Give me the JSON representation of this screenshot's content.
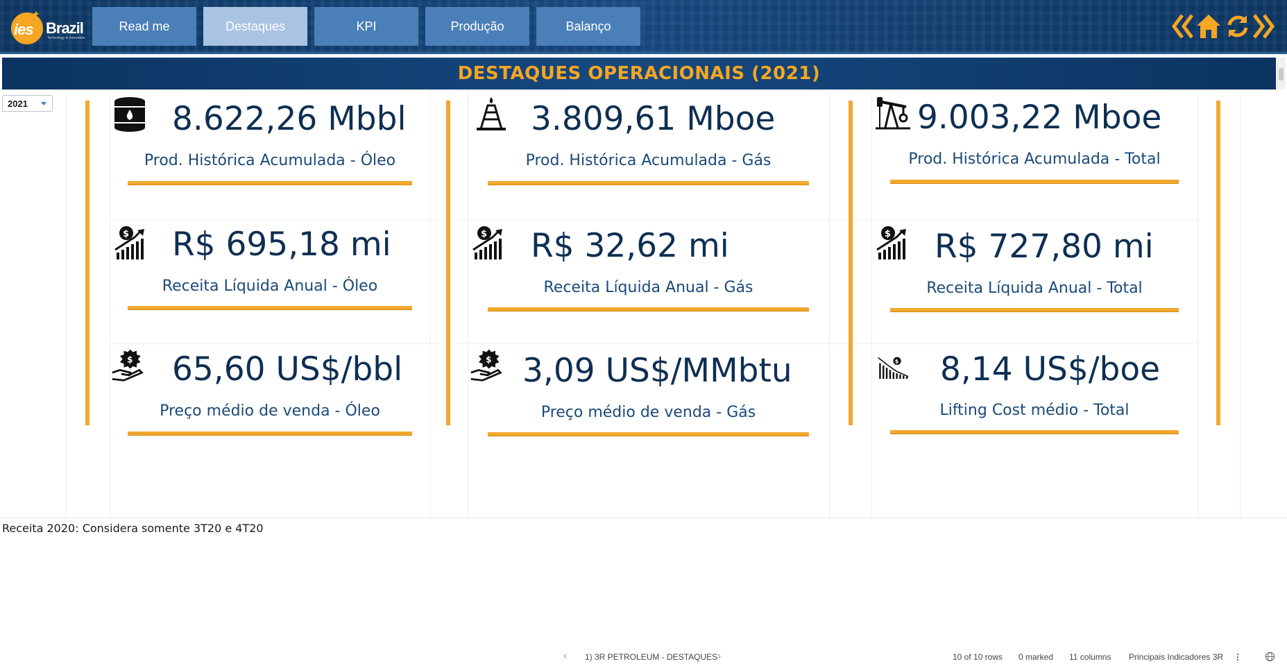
{
  "header": {
    "logo_primary": "ies",
    "logo_secondary": "Brazil",
    "logo_tagline": "Technology & Innovation",
    "nav": [
      {
        "label": "Read me",
        "active": false
      },
      {
        "label": "Destaques",
        "active": true
      },
      {
        "label": "KPI",
        "active": false
      },
      {
        "label": "Produção",
        "active": false
      },
      {
        "label": "Balanço",
        "active": false
      }
    ],
    "icons": [
      "back-icon",
      "home-icon",
      "refresh-icon",
      "forward-icon"
    ]
  },
  "banner": {
    "title": "DESTAQUES OPERACIONAIS (2021)"
  },
  "filter": {
    "year": "2021"
  },
  "kpis": {
    "oil_prod": {
      "value": "8.622,26 Mbbl",
      "label": "Prod. Histórica Acumulada - Óleo",
      "icon": "oil-barrel-icon"
    },
    "gas_prod": {
      "value": "3.809,61 Mboe",
      "label": "Prod. Histórica Acumulada - Gás",
      "icon": "gas-rig-icon"
    },
    "total_prod": {
      "value": "9.003,22 Mboe",
      "label": "Prod. Histórica Acumulada - Total",
      "icon": "pumpjack-icon"
    },
    "oil_rev": {
      "value": "R$ 695,18 mi",
      "label": "Receita Líquida Anual - Óleo",
      "icon": "revenue-growth-icon"
    },
    "gas_rev": {
      "value": "R$ 32,62 mi",
      "label": "Receita Líquida Anual - Gás",
      "icon": "revenue-growth-icon"
    },
    "total_rev": {
      "value": "R$ 727,80 mi",
      "label": "Receita Líquida Anual - Total",
      "icon": "revenue-growth-icon"
    },
    "oil_price": {
      "value": "65,60 US$/bbl",
      "label": "Preço médio de venda - Óleo",
      "icon": "money-hand-icon"
    },
    "gas_price": {
      "value": "3,09 US$/MMbtu",
      "label": "Preço médio de venda - Gás",
      "icon": "money-hand-icon"
    },
    "lifting_cost": {
      "value": "8,14 US$/boe",
      "label": "Lifting Cost médio - Total",
      "icon": "cost-decline-icon"
    }
  },
  "footnote": "Receita 2020: Considera somente 3T20 e 4T20",
  "status": {
    "page": "1) 3R PETROLEUM - DESTAQUES",
    "rows": "10 of 10 rows",
    "marked": "0 marked",
    "columns": "11 columns",
    "table": "Principais Indicadores 3R"
  },
  "colors": {
    "navy": "#0e3a6a",
    "accent_orange": "#f0a82e",
    "value_text": "#0e2f52",
    "nav_button": "#4a7fb8",
    "nav_button_active": "#a9c3e2"
  }
}
